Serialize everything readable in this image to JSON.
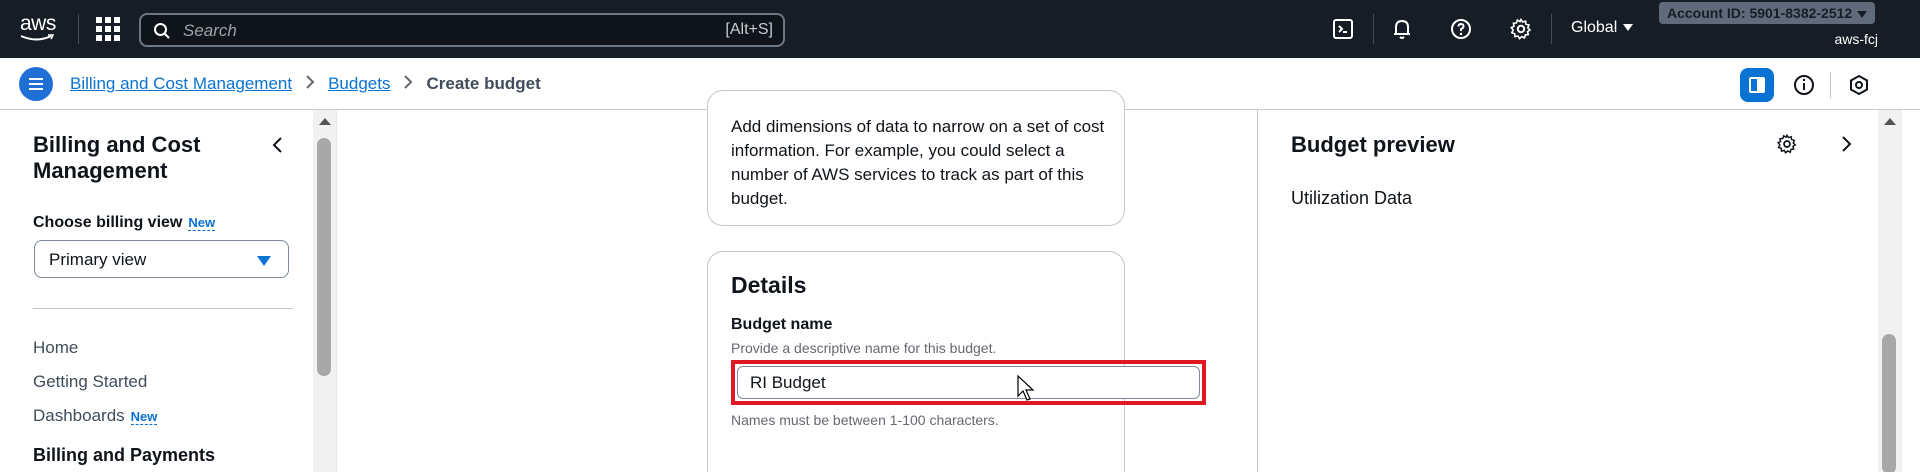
{
  "topbar": {
    "logo_text": "aws",
    "search_placeholder": "Search",
    "search_shortcut": "[Alt+S]",
    "region": "Global",
    "account_id": "Account ID: 5901-8382-2512",
    "user": "aws-fcj"
  },
  "breadcrumb": {
    "items": [
      "Billing and Cost Management",
      "Budgets"
    ],
    "current": "Create budget"
  },
  "sidebar": {
    "title": "Billing and Cost Management",
    "billing_view_label": "Choose billing view",
    "new_badge": "New",
    "billing_view_value": "Primary view",
    "items": [
      {
        "label": "Home"
      },
      {
        "label": "Getting Started"
      },
      {
        "label": "Dashboards",
        "badge": "New"
      }
    ],
    "section": "Billing and Payments"
  },
  "main": {
    "filter_description": "Add dimensions of data to narrow on a set of cost information. For example, you could select a number of AWS services to track as part of this budget.",
    "details": {
      "heading": "Details",
      "field_label": "Budget name",
      "field_description": "Provide a descriptive name for this budget.",
      "field_value": "RI Budget",
      "field_hint": "Names must be between 1-100 characters."
    }
  },
  "preview": {
    "title": "Budget preview",
    "subtitle": "Utilization Data"
  },
  "colors": {
    "topbar_bg": "#161d26",
    "link": "#0972d3",
    "highlight": "#e01824"
  }
}
